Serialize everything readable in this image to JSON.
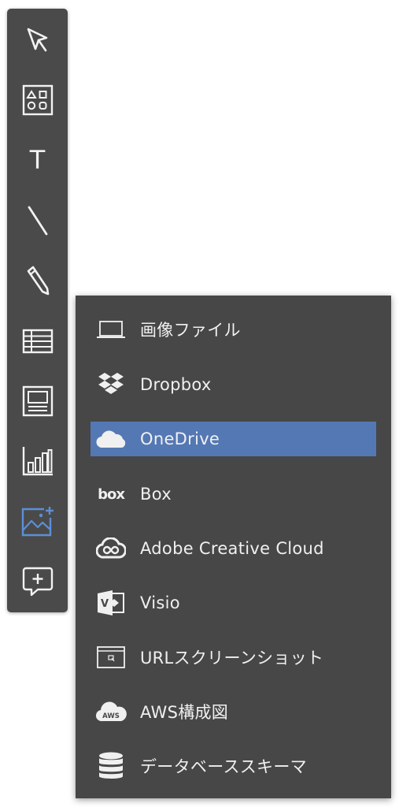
{
  "toolbar": {
    "tools": [
      {
        "name": "select",
        "icon": "cursor-icon"
      },
      {
        "name": "shapes",
        "icon": "shapes-icon"
      },
      {
        "name": "text",
        "icon": "text-icon",
        "glyph": "T"
      },
      {
        "name": "line",
        "icon": "line-icon"
      },
      {
        "name": "pen",
        "icon": "pencil-icon"
      },
      {
        "name": "table",
        "icon": "table-icon"
      },
      {
        "name": "card",
        "icon": "card-icon"
      },
      {
        "name": "chart",
        "icon": "bar-chart-icon"
      },
      {
        "name": "image",
        "icon": "image-add-icon",
        "active": true
      },
      {
        "name": "comment",
        "icon": "comment-add-icon"
      }
    ],
    "active_color": "#5b8fd6",
    "icon_color": "#f2f2f2"
  },
  "menu": {
    "items": [
      {
        "label": "画像ファイル",
        "icon": "image-file-icon"
      },
      {
        "label": "Dropbox",
        "icon": "dropbox-icon"
      },
      {
        "label": "OneDrive",
        "icon": "onedrive-cloud-icon",
        "selected": true
      },
      {
        "label": "Box",
        "icon": "box-logo-icon",
        "logo_text": "box"
      },
      {
        "label": "Adobe Creative Cloud",
        "icon": "creative-cloud-icon"
      },
      {
        "label": "Visio",
        "icon": "visio-icon",
        "logo_text": "V"
      },
      {
        "label": "URLスクリーンショット",
        "icon": "browser-window-icon"
      },
      {
        "label": "AWS構成図",
        "icon": "aws-cloud-icon",
        "logo_text": "AWS"
      },
      {
        "label": "データベーススキーマ",
        "icon": "database-icon"
      }
    ],
    "selected_color": "#5478b4",
    "background_color": "#474747"
  }
}
